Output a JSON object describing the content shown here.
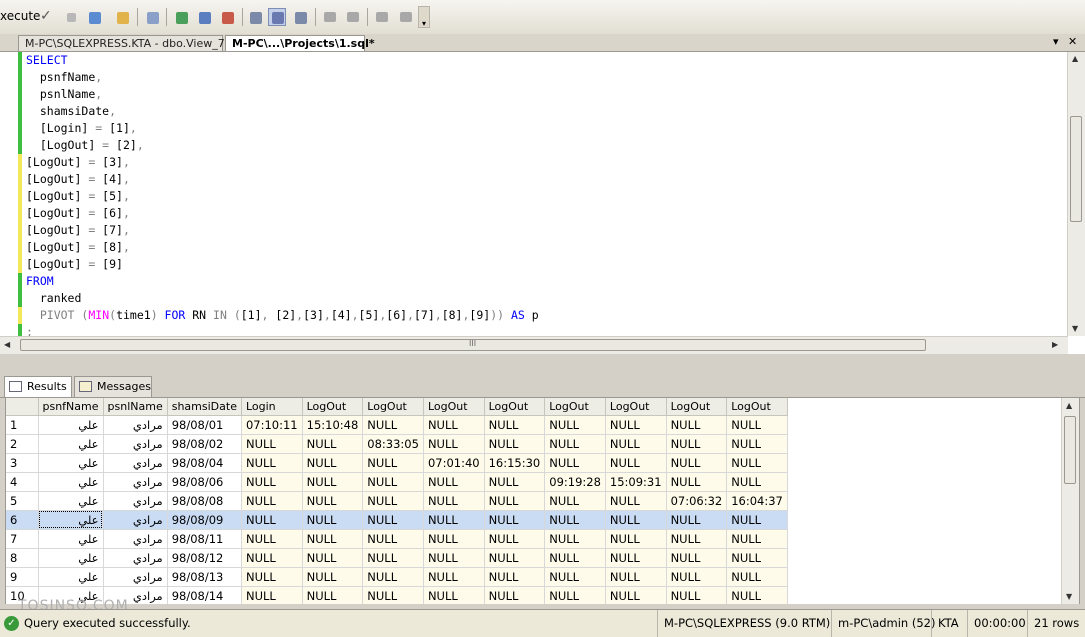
{
  "toolbar": {
    "execute_label": "xecute",
    "buttons": [
      "parse-icon",
      "stop-icon",
      "debug-icon",
      "design-query-icon",
      "specify-values-icon",
      "display-plan-icon",
      "query-options-icon",
      "intellisense-icon",
      "results-to-text-icon",
      "results-to-grid-icon",
      "results-to-file-icon",
      "comment-icon",
      "uncomment-icon",
      "decrease-indent-icon",
      "increase-indent-icon"
    ]
  },
  "tabs": [
    {
      "label": "M-PC\\SQLEXPRESS.KTA - dbo.View_7"
    },
    {
      "label": "M-PC\\...\\Projects\\1.sql*"
    }
  ],
  "tab_controls": {
    "dropdown": "▾",
    "close": "✕"
  },
  "editor": {
    "lines": [
      {
        "indent": "",
        "parts": [
          {
            "t": "SELECT",
            "c": "kw"
          }
        ]
      },
      {
        "indent": "  ",
        "parts": [
          {
            "t": "psnfName",
            "c": ""
          },
          {
            "t": ",",
            "c": "op"
          }
        ]
      },
      {
        "indent": "  ",
        "parts": [
          {
            "t": "psnlName",
            "c": ""
          },
          {
            "t": ",",
            "c": "op"
          }
        ]
      },
      {
        "indent": "  ",
        "parts": [
          {
            "t": "shamsiDate",
            "c": ""
          },
          {
            "t": ",",
            "c": "op"
          }
        ]
      },
      {
        "indent": "  ",
        "parts": [
          {
            "t": "[Login] ",
            "c": ""
          },
          {
            "t": "=",
            "c": "op"
          },
          {
            "t": " [1]",
            "c": ""
          },
          {
            "t": ",",
            "c": "op"
          }
        ]
      },
      {
        "indent": "  ",
        "parts": [
          {
            "t": "[LogOut] ",
            "c": ""
          },
          {
            "t": "=",
            "c": "op"
          },
          {
            "t": " [2]",
            "c": ""
          },
          {
            "t": ",",
            "c": "op"
          }
        ]
      },
      {
        "indent": "",
        "parts": [
          {
            "t": "[LogOut] ",
            "c": ""
          },
          {
            "t": "=",
            "c": "op"
          },
          {
            "t": " [3]",
            "c": ""
          },
          {
            "t": ",",
            "c": "op"
          }
        ]
      },
      {
        "indent": "",
        "parts": [
          {
            "t": "[LogOut] ",
            "c": ""
          },
          {
            "t": "=",
            "c": "op"
          },
          {
            "t": " [4]",
            "c": ""
          },
          {
            "t": ",",
            "c": "op"
          }
        ]
      },
      {
        "indent": "",
        "parts": [
          {
            "t": "[LogOut] ",
            "c": ""
          },
          {
            "t": "=",
            "c": "op"
          },
          {
            "t": " [5]",
            "c": ""
          },
          {
            "t": ",",
            "c": "op"
          }
        ]
      },
      {
        "indent": "",
        "parts": [
          {
            "t": "[LogOut] ",
            "c": ""
          },
          {
            "t": "=",
            "c": "op"
          },
          {
            "t": " [6]",
            "c": ""
          },
          {
            "t": ",",
            "c": "op"
          }
        ]
      },
      {
        "indent": "",
        "parts": [
          {
            "t": "[LogOut] ",
            "c": ""
          },
          {
            "t": "=",
            "c": "op"
          },
          {
            "t": " [7]",
            "c": ""
          },
          {
            "t": ",",
            "c": "op"
          }
        ]
      },
      {
        "indent": "",
        "parts": [
          {
            "t": "[LogOut] ",
            "c": ""
          },
          {
            "t": "=",
            "c": "op"
          },
          {
            "t": " [8]",
            "c": ""
          },
          {
            "t": ",",
            "c": "op"
          }
        ]
      },
      {
        "indent": "",
        "parts": [
          {
            "t": "[LogOut] ",
            "c": ""
          },
          {
            "t": "=",
            "c": "op"
          },
          {
            "t": " [9]",
            "c": ""
          }
        ]
      },
      {
        "indent": "",
        "parts": [
          {
            "t": "FROM",
            "c": "kw"
          }
        ]
      },
      {
        "indent": "  ",
        "parts": [
          {
            "t": "ranked",
            "c": ""
          }
        ]
      },
      {
        "indent": "  ",
        "parts": [
          {
            "t": "PIVOT",
            "c": "op"
          },
          {
            "t": " (",
            "c": "op"
          },
          {
            "t": "MIN",
            "c": "fn"
          },
          {
            "t": "(",
            "c": "op"
          },
          {
            "t": "time1",
            "c": ""
          },
          {
            "t": ")",
            "c": "op"
          },
          {
            "t": " FOR ",
            "c": "kw"
          },
          {
            "t": "RN",
            "c": ""
          },
          {
            "t": " IN ",
            "c": "op"
          },
          {
            "t": "(",
            "c": "op"
          },
          {
            "t": "[1]",
            "c": ""
          },
          {
            "t": ", ",
            "c": "op"
          },
          {
            "t": "[2]",
            "c": ""
          },
          {
            "t": ",",
            "c": "op"
          },
          {
            "t": "[3]",
            "c": ""
          },
          {
            "t": ",",
            "c": "op"
          },
          {
            "t": "[4]",
            "c": ""
          },
          {
            "t": ",",
            "c": "op"
          },
          {
            "t": "[5]",
            "c": ""
          },
          {
            "t": ",",
            "c": "op"
          },
          {
            "t": "[6]",
            "c": ""
          },
          {
            "t": ",",
            "c": "op"
          },
          {
            "t": "[7]",
            "c": ""
          },
          {
            "t": ",",
            "c": "op"
          },
          {
            "t": "[8]",
            "c": ""
          },
          {
            "t": ",",
            "c": "op"
          },
          {
            "t": "[9]",
            "c": ""
          },
          {
            "t": "))",
            "c": "op"
          },
          {
            "t": " AS ",
            "c": "kw"
          },
          {
            "t": "p",
            "c": ""
          }
        ]
      },
      {
        "indent": "",
        "parts": [
          {
            "t": ";",
            "c": "op"
          }
        ]
      }
    ],
    "scroll_grip": "III"
  },
  "results_tabs": [
    {
      "label": "Results"
    },
    {
      "label": "Messages"
    }
  ],
  "grid": {
    "columns": [
      "",
      "psnfName",
      "psnlName",
      "shamsiDate",
      "Login",
      "LogOut",
      "LogOut",
      "LogOut",
      "LogOut",
      "LogOut",
      "LogOut",
      "LogOut",
      "LogOut"
    ],
    "rows": [
      [
        "1",
        "علي",
        "مرادي",
        "98/08/01",
        "07:10:11",
        "15:10:48",
        "NULL",
        "NULL",
        "NULL",
        "NULL",
        "NULL",
        "NULL",
        "NULL"
      ],
      [
        "2",
        "علي",
        "مرادي",
        "98/08/02",
        "NULL",
        "NULL",
        "08:33:05",
        "NULL",
        "NULL",
        "NULL",
        "NULL",
        "NULL",
        "NULL"
      ],
      [
        "3",
        "علي",
        "مرادي",
        "98/08/04",
        "NULL",
        "NULL",
        "NULL",
        "07:01:40",
        "16:15:30",
        "NULL",
        "NULL",
        "NULL",
        "NULL"
      ],
      [
        "4",
        "علي",
        "مرادي",
        "98/08/06",
        "NULL",
        "NULL",
        "NULL",
        "NULL",
        "NULL",
        "09:19:28",
        "15:09:31",
        "NULL",
        "NULL"
      ],
      [
        "5",
        "علي",
        "مرادي",
        "98/08/08",
        "NULL",
        "NULL",
        "NULL",
        "NULL",
        "NULL",
        "NULL",
        "NULL",
        "07:06:32",
        "16:04:37"
      ],
      [
        "6",
        "علي",
        "مرادي",
        "98/08/09",
        "NULL",
        "NULL",
        "NULL",
        "NULL",
        "NULL",
        "NULL",
        "NULL",
        "NULL",
        "NULL"
      ],
      [
        "7",
        "علي",
        "مرادي",
        "98/08/11",
        "NULL",
        "NULL",
        "NULL",
        "NULL",
        "NULL",
        "NULL",
        "NULL",
        "NULL",
        "NULL"
      ],
      [
        "8",
        "علي",
        "مرادي",
        "98/08/12",
        "NULL",
        "NULL",
        "NULL",
        "NULL",
        "NULL",
        "NULL",
        "NULL",
        "NULL",
        "NULL"
      ],
      [
        "9",
        "علي",
        "مرادي",
        "98/08/13",
        "NULL",
        "NULL",
        "NULL",
        "NULL",
        "NULL",
        "NULL",
        "NULL",
        "NULL",
        "NULL"
      ],
      [
        "10",
        "علي",
        "مرادي",
        "98/08/14",
        "NULL",
        "NULL",
        "NULL",
        "NULL",
        "NULL",
        "NULL",
        "NULL",
        "NULL",
        "NULL"
      ]
    ],
    "selected_row": 6
  },
  "status": {
    "message": "Query executed successfully.",
    "server": "M-PC\\SQLEXPRESS (9.0 RTM)",
    "user": "m-PC\\admin (52)",
    "database": "KTA",
    "elapsed": "00:00:00",
    "rows": "21 rows"
  },
  "watermark": "TOSINSO.COM"
}
